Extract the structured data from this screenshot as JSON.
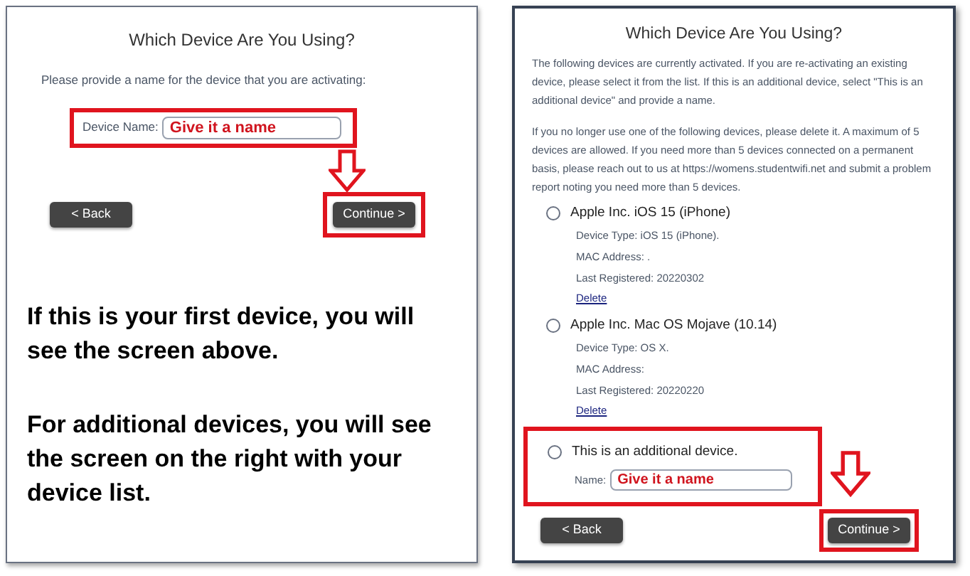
{
  "left_screen": {
    "title": "Which Device Are You Using?",
    "instructions": "Please provide a name for the device that you are activating:",
    "device_name": {
      "label": "Device Name:",
      "value": "Give it a name"
    },
    "buttons": {
      "back": "< Back",
      "continue": "Continue >"
    }
  },
  "caption": [
    "If this is your first device, you will see the screen above.",
    "For additional devices, you will see the screen on the right with your device list."
  ],
  "right_screen": {
    "title": "Which Device Are You Using?",
    "paragraphs": [
      "The following devices are currently activated. If you are re-activating an existing device, please select it from the list. If this is an additional device, select \"This is an additional device\" and provide a name.",
      "If you no longer use one of the following devices, please delete it. A maximum of 5 devices are allowed. If you need more than 5 devices connected on a permanent basis, please reach out to us at https://womens.studentwifi.net and submit a problem report noting you need more than 5 devices."
    ],
    "devices": [
      {
        "name": "Apple Inc. iOS 15 (iPhone)",
        "selected": false,
        "details": [
          "Device Type: iOS 15 (iPhone).",
          "MAC Address: .",
          "Last Registered: 20220302"
        ],
        "delete": "Delete"
      },
      {
        "name": "Apple Inc. Mac OS Mojave (10.14)",
        "selected": false,
        "details": [
          "Device Type: OS X.",
          "MAC Address:",
          "Last Registered: 20220220"
        ],
        "delete": "Delete"
      }
    ],
    "additional": {
      "label": "This is an additional device.",
      "selected": false,
      "name_label": "Name:",
      "value": "Give it a name"
    },
    "buttons": {
      "back": "< Back",
      "continue": "Continue >"
    }
  }
}
